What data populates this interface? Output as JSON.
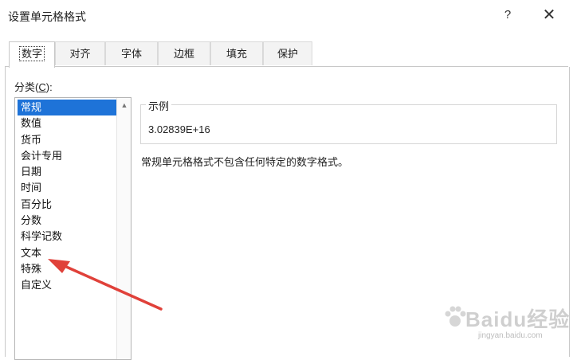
{
  "dialog": {
    "title": "设置单元格格式",
    "help_label": "?",
    "close_label": "✕"
  },
  "tabs": [
    {
      "label": "数字",
      "active": true
    },
    {
      "label": "对齐",
      "active": false
    },
    {
      "label": "字体",
      "active": false
    },
    {
      "label": "边框",
      "active": false
    },
    {
      "label": "填充",
      "active": false
    },
    {
      "label": "保护",
      "active": false
    }
  ],
  "category": {
    "label_prefix": "分类(",
    "label_hotkey": "C",
    "label_suffix": "):",
    "items": [
      "常规",
      "数值",
      "货币",
      "会计专用",
      "日期",
      "时间",
      "百分比",
      "分数",
      "科学记数",
      "文本",
      "特殊",
      "自定义"
    ],
    "selected": "常规"
  },
  "sample": {
    "legend": "示例",
    "value": "3.02839E+16"
  },
  "description": "常规单元格格式不包含任何特定的数字格式。",
  "annotation": {
    "arrow_color": "#e0413a",
    "points_to": "文本"
  },
  "watermark": {
    "text": "Baidu经验",
    "sub": "jingyan.baidu.com"
  },
  "colors": {
    "selection": "#1e73d8",
    "border": "#c8c8c8"
  }
}
